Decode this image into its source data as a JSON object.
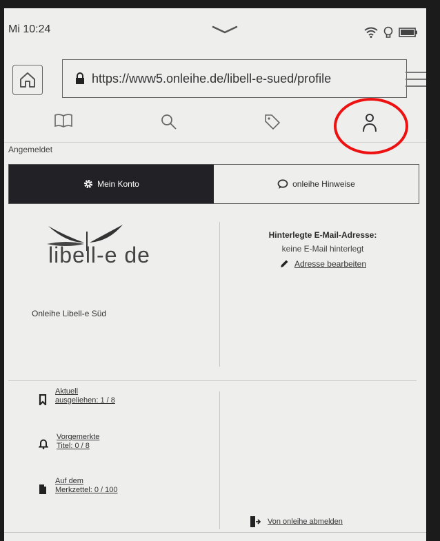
{
  "status": {
    "time": "Mi 10:24"
  },
  "browser": {
    "url": "https://www5.onleihe.de/libell-e-sued/profile"
  },
  "nav_tabs": [
    "book-icon",
    "search-icon",
    "tag-icon",
    "user-icon"
  ],
  "account": {
    "logged_in_label": "Angemeldet",
    "tabs": [
      {
        "label": "Mein Konto",
        "active": true
      },
      {
        "label": "onleihe Hinweise",
        "active": false
      }
    ]
  },
  "library": {
    "logo_text": "libell-e de",
    "name": "Onleihe Libell-e Süd"
  },
  "email": {
    "title": "Hinterlegte E-Mail-Adresse:",
    "value": "keine E-Mail hinterlegt",
    "edit_link": "Adresse bearbeiten"
  },
  "stats": [
    {
      "icon": "bookmark-icon",
      "line1": "Aktuell",
      "line2": "ausgeliehen: 1 / 8"
    },
    {
      "icon": "bell-icon",
      "line1": "Vorgemerkte",
      "line2": "Titel: 0 / 8"
    },
    {
      "icon": "document-icon",
      "line1": "Auf dem",
      "line2": "Merkzettel: 0 / 100"
    }
  ],
  "logout_label": "Von onleihe abmelden",
  "colors": {
    "active_tab_bg": "#222226",
    "highlight_circle": "#e11111",
    "screen_bg": "#eeeeec"
  }
}
